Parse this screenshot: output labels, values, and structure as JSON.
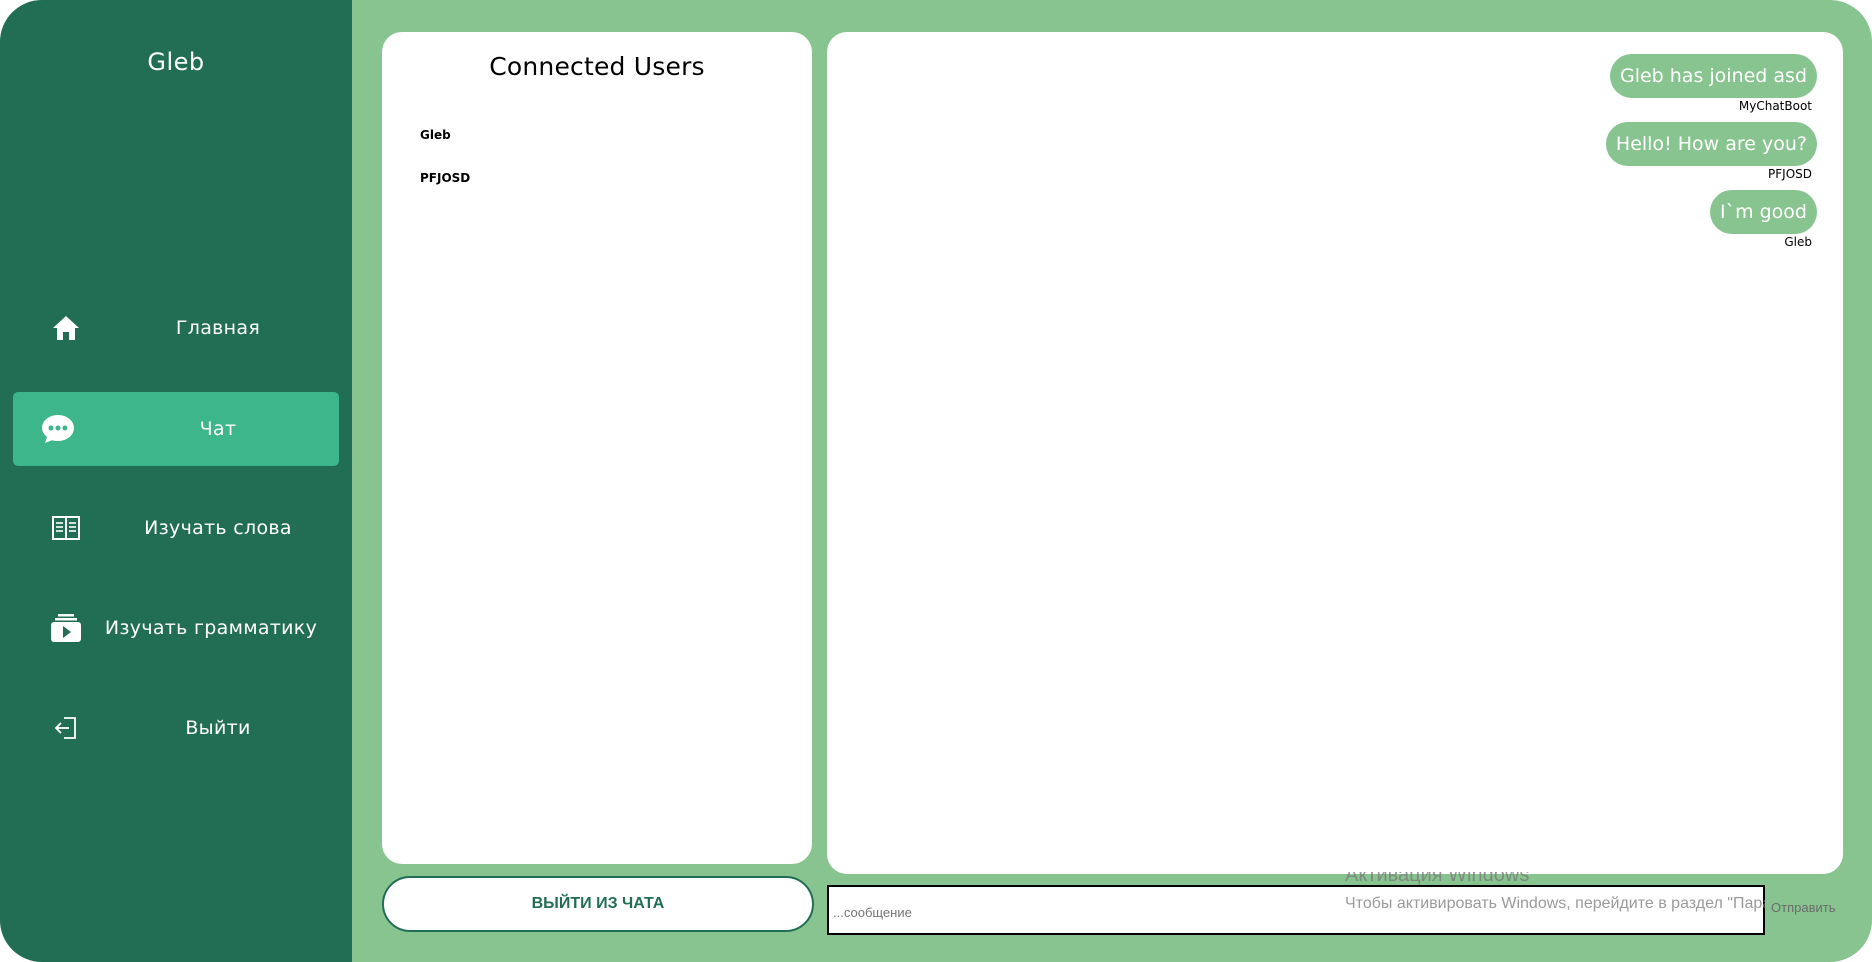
{
  "sidebar": {
    "username": "Gleb",
    "items": [
      {
        "label": "Главная",
        "icon": "home-icon"
      },
      {
        "label": "Чат",
        "icon": "chat-icon",
        "active": true
      },
      {
        "label": "Изучать слова",
        "icon": "book-icon"
      },
      {
        "label": "Изучать грамматику",
        "icon": "video-library-icon"
      },
      {
        "label": "Выйти",
        "icon": "logout-icon"
      }
    ]
  },
  "users_panel": {
    "title": "Connected Users",
    "users": [
      "Gleb",
      "PFJOSD"
    ]
  },
  "chat": {
    "messages": [
      {
        "text": "Gleb has joined asd",
        "sender": "MyChatBoot"
      },
      {
        "text": "Hello! How are you?",
        "sender": "PFJOSD"
      },
      {
        "text": "I`m good",
        "sender": "Gleb"
      }
    ]
  },
  "leave_button": {
    "label": "ВЫЙТИ ИЗ ЧАТА"
  },
  "composer": {
    "placeholder": "...сообщение",
    "send_label": "Отправить"
  },
  "os_overlay": {
    "activation_title": "Активация Windows",
    "activation_text": "Чтобы активировать Windows, перейдите в раздел \"Параметры\"."
  },
  "colors": {
    "background": "#88c48f",
    "sidebar": "#226e55",
    "active_item": "#3cb68a",
    "bubble": "#88c48f"
  }
}
